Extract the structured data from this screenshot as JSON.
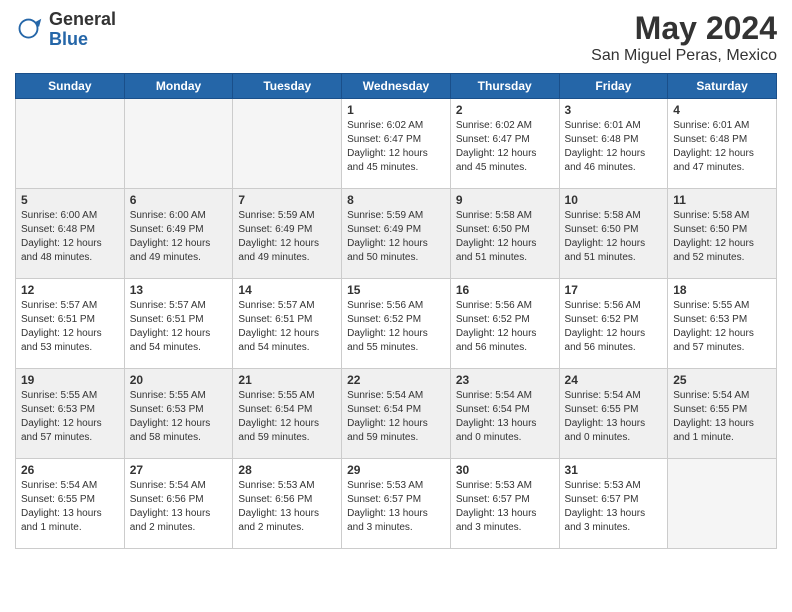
{
  "logo": {
    "general": "General",
    "blue": "Blue"
  },
  "title": "May 2024",
  "location": "San Miguel Peras, Mexico",
  "days_of_week": [
    "Sunday",
    "Monday",
    "Tuesday",
    "Wednesday",
    "Thursday",
    "Friday",
    "Saturday"
  ],
  "weeks": [
    [
      {
        "num": "",
        "info": ""
      },
      {
        "num": "",
        "info": ""
      },
      {
        "num": "",
        "info": ""
      },
      {
        "num": "1",
        "info": "Sunrise: 6:02 AM\nSunset: 6:47 PM\nDaylight: 12 hours\nand 45 minutes."
      },
      {
        "num": "2",
        "info": "Sunrise: 6:02 AM\nSunset: 6:47 PM\nDaylight: 12 hours\nand 45 minutes."
      },
      {
        "num": "3",
        "info": "Sunrise: 6:01 AM\nSunset: 6:48 PM\nDaylight: 12 hours\nand 46 minutes."
      },
      {
        "num": "4",
        "info": "Sunrise: 6:01 AM\nSunset: 6:48 PM\nDaylight: 12 hours\nand 47 minutes."
      }
    ],
    [
      {
        "num": "5",
        "info": "Sunrise: 6:00 AM\nSunset: 6:48 PM\nDaylight: 12 hours\nand 48 minutes."
      },
      {
        "num": "6",
        "info": "Sunrise: 6:00 AM\nSunset: 6:49 PM\nDaylight: 12 hours\nand 49 minutes."
      },
      {
        "num": "7",
        "info": "Sunrise: 5:59 AM\nSunset: 6:49 PM\nDaylight: 12 hours\nand 49 minutes."
      },
      {
        "num": "8",
        "info": "Sunrise: 5:59 AM\nSunset: 6:49 PM\nDaylight: 12 hours\nand 50 minutes."
      },
      {
        "num": "9",
        "info": "Sunrise: 5:58 AM\nSunset: 6:50 PM\nDaylight: 12 hours\nand 51 minutes."
      },
      {
        "num": "10",
        "info": "Sunrise: 5:58 AM\nSunset: 6:50 PM\nDaylight: 12 hours\nand 51 minutes."
      },
      {
        "num": "11",
        "info": "Sunrise: 5:58 AM\nSunset: 6:50 PM\nDaylight: 12 hours\nand 52 minutes."
      }
    ],
    [
      {
        "num": "12",
        "info": "Sunrise: 5:57 AM\nSunset: 6:51 PM\nDaylight: 12 hours\nand 53 minutes."
      },
      {
        "num": "13",
        "info": "Sunrise: 5:57 AM\nSunset: 6:51 PM\nDaylight: 12 hours\nand 54 minutes."
      },
      {
        "num": "14",
        "info": "Sunrise: 5:57 AM\nSunset: 6:51 PM\nDaylight: 12 hours\nand 54 minutes."
      },
      {
        "num": "15",
        "info": "Sunrise: 5:56 AM\nSunset: 6:52 PM\nDaylight: 12 hours\nand 55 minutes."
      },
      {
        "num": "16",
        "info": "Sunrise: 5:56 AM\nSunset: 6:52 PM\nDaylight: 12 hours\nand 56 minutes."
      },
      {
        "num": "17",
        "info": "Sunrise: 5:56 AM\nSunset: 6:52 PM\nDaylight: 12 hours\nand 56 minutes."
      },
      {
        "num": "18",
        "info": "Sunrise: 5:55 AM\nSunset: 6:53 PM\nDaylight: 12 hours\nand 57 minutes."
      }
    ],
    [
      {
        "num": "19",
        "info": "Sunrise: 5:55 AM\nSunset: 6:53 PM\nDaylight: 12 hours\nand 57 minutes."
      },
      {
        "num": "20",
        "info": "Sunrise: 5:55 AM\nSunset: 6:53 PM\nDaylight: 12 hours\nand 58 minutes."
      },
      {
        "num": "21",
        "info": "Sunrise: 5:55 AM\nSunset: 6:54 PM\nDaylight: 12 hours\nand 59 minutes."
      },
      {
        "num": "22",
        "info": "Sunrise: 5:54 AM\nSunset: 6:54 PM\nDaylight: 12 hours\nand 59 minutes."
      },
      {
        "num": "23",
        "info": "Sunrise: 5:54 AM\nSunset: 6:54 PM\nDaylight: 13 hours\nand 0 minutes."
      },
      {
        "num": "24",
        "info": "Sunrise: 5:54 AM\nSunset: 6:55 PM\nDaylight: 13 hours\nand 0 minutes."
      },
      {
        "num": "25",
        "info": "Sunrise: 5:54 AM\nSunset: 6:55 PM\nDaylight: 13 hours\nand 1 minute."
      }
    ],
    [
      {
        "num": "26",
        "info": "Sunrise: 5:54 AM\nSunset: 6:55 PM\nDaylight: 13 hours\nand 1 minute."
      },
      {
        "num": "27",
        "info": "Sunrise: 5:54 AM\nSunset: 6:56 PM\nDaylight: 13 hours\nand 2 minutes."
      },
      {
        "num": "28",
        "info": "Sunrise: 5:53 AM\nSunset: 6:56 PM\nDaylight: 13 hours\nand 2 minutes."
      },
      {
        "num": "29",
        "info": "Sunrise: 5:53 AM\nSunset: 6:57 PM\nDaylight: 13 hours\nand 3 minutes."
      },
      {
        "num": "30",
        "info": "Sunrise: 5:53 AM\nSunset: 6:57 PM\nDaylight: 13 hours\nand 3 minutes."
      },
      {
        "num": "31",
        "info": "Sunrise: 5:53 AM\nSunset: 6:57 PM\nDaylight: 13 hours\nand 3 minutes."
      },
      {
        "num": "",
        "info": ""
      }
    ]
  ]
}
